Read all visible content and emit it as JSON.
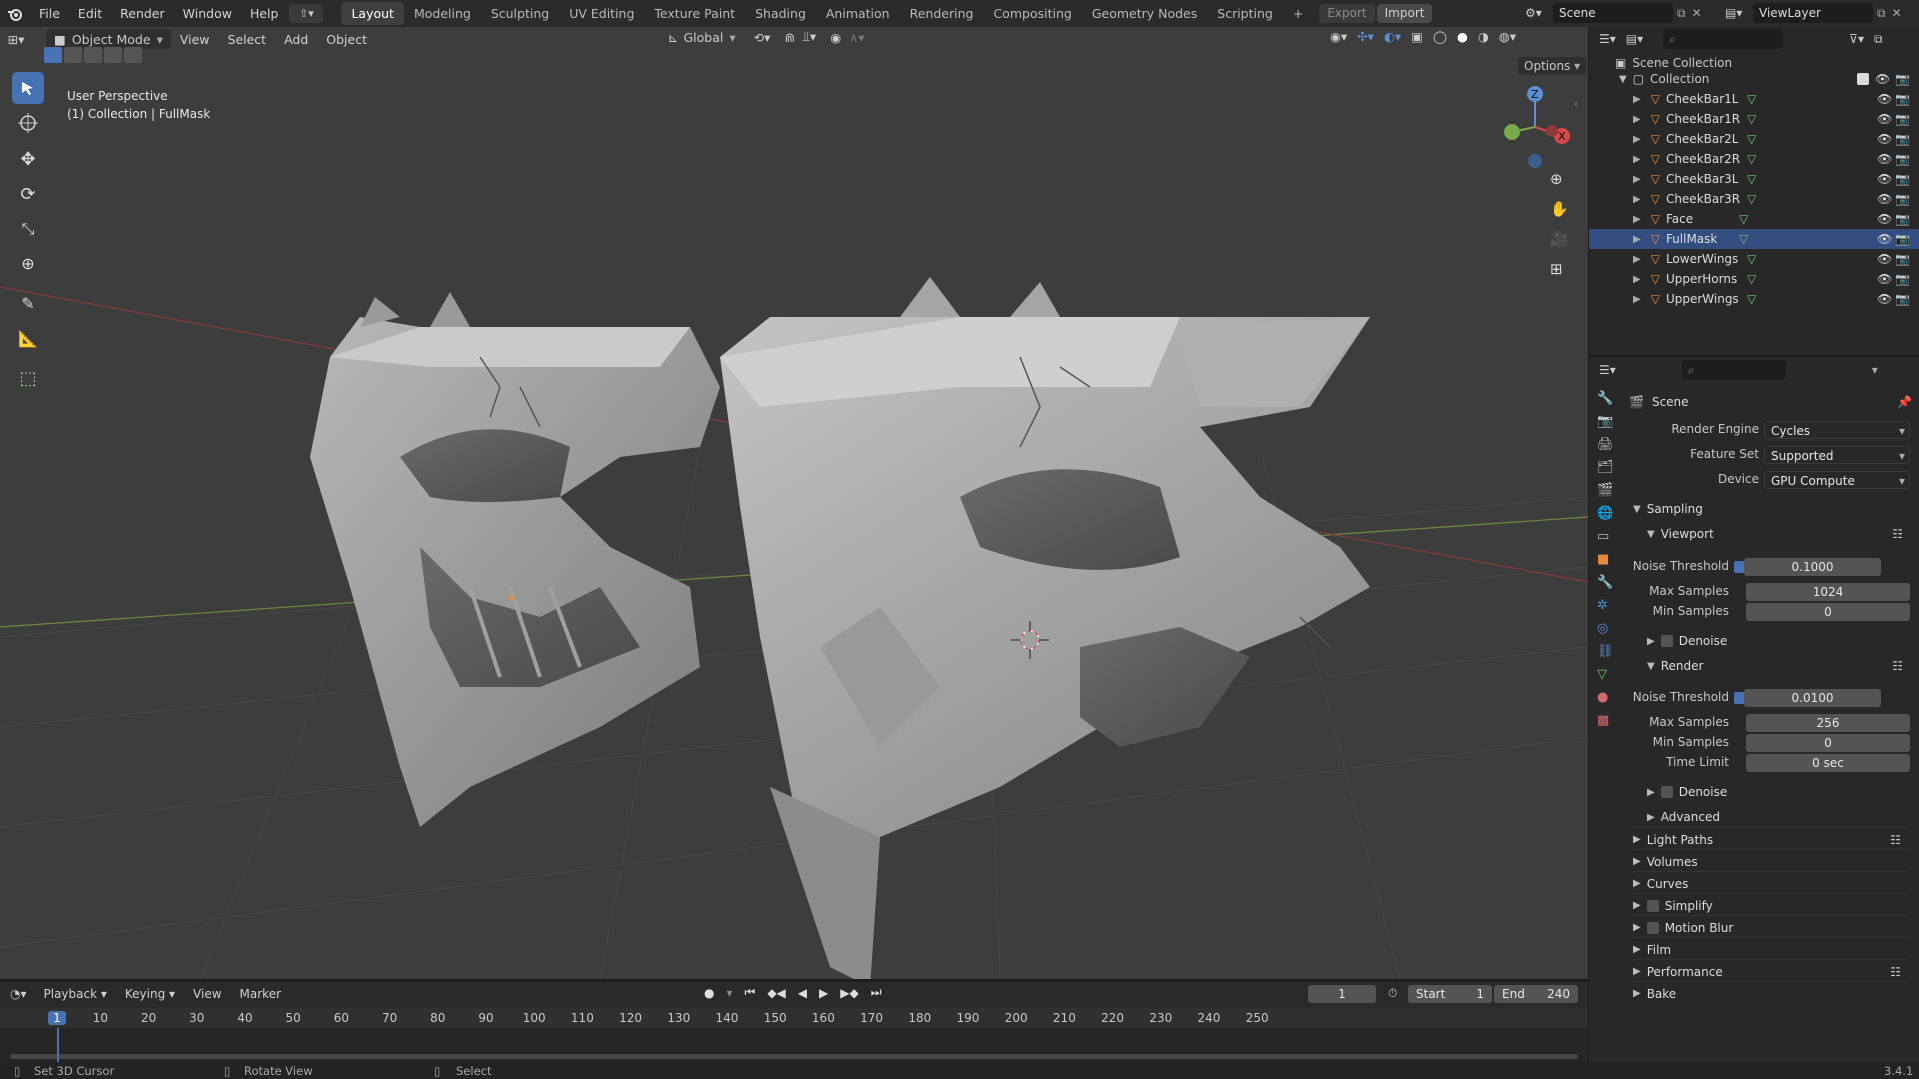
{
  "menus": [
    "File",
    "Edit",
    "Render",
    "Window",
    "Help"
  ],
  "workspaces": [
    "Layout",
    "Modeling",
    "Sculpting",
    "UV Editing",
    "Texture Paint",
    "Shading",
    "Animation",
    "Rendering",
    "Compositing",
    "Geometry Nodes",
    "Scripting"
  ],
  "active_workspace": "Layout",
  "topbar": {
    "export_label": "Export",
    "import_label": "Import",
    "scene_name": "Scene",
    "viewlayer_name": "ViewLayer",
    "add_tab": "+"
  },
  "viewport": {
    "mode": "Object Mode",
    "menus": [
      "View",
      "Select",
      "Add",
      "Object"
    ],
    "transform_orientation": "Global",
    "options_label": "Options",
    "overlay_line1": "User Perspective",
    "overlay_line2": "(1) Collection | FullMask",
    "gizmo_axes": [
      "Z",
      "X",
      "Y"
    ]
  },
  "outliner": {
    "scene_collection": "Scene Collection",
    "collection": "Collection",
    "objects": [
      {
        "name": "CheekBar1L"
      },
      {
        "name": "CheekBar1R"
      },
      {
        "name": "CheekBar2L"
      },
      {
        "name": "CheekBar2R"
      },
      {
        "name": "CheekBar3L"
      },
      {
        "name": "CheekBar3R"
      },
      {
        "name": "Face"
      },
      {
        "name": "FullMask"
      },
      {
        "name": "LowerWings"
      },
      {
        "name": "UpperHorns"
      },
      {
        "name": "UpperWings"
      }
    ],
    "selected": "FullMask"
  },
  "properties": {
    "context": "Scene",
    "render_engine_label": "Render Engine",
    "render_engine": "Cycles",
    "feature_set_label": "Feature Set",
    "feature_set": "Supported",
    "device_label": "Device",
    "device": "GPU Compute",
    "sampling": "Sampling",
    "viewport": {
      "title": "Viewport",
      "noise_threshold_label": "Noise Threshold",
      "noise_threshold": "0.1000",
      "max_samples_label": "Max Samples",
      "max_samples": "1024",
      "min_samples_label": "Min Samples",
      "min_samples": "0",
      "denoise": "Denoise"
    },
    "render": {
      "title": "Render",
      "noise_threshold_label": "Noise Threshold",
      "noise_threshold": "0.0100",
      "max_samples_label": "Max Samples",
      "max_samples": "256",
      "min_samples_label": "Min Samples",
      "min_samples": "0",
      "time_limit_label": "Time Limit",
      "time_limit": "0 sec",
      "denoise": "Denoise",
      "advanced": "Advanced"
    },
    "panels": [
      "Light Paths",
      "Volumes",
      "Curves",
      "Simplify",
      "Motion Blur",
      "Film",
      "Performance",
      "Bake"
    ]
  },
  "timeline": {
    "menus": [
      "Playback",
      "Keying",
      "View",
      "Marker"
    ],
    "current_frame": "1",
    "start_label": "Start",
    "start": "1",
    "end_label": "End",
    "end": "240",
    "ticks": [
      "1",
      "10",
      "20",
      "30",
      "40",
      "50",
      "60",
      "70",
      "80",
      "90",
      "100",
      "110",
      "120",
      "130",
      "140",
      "150",
      "160",
      "170",
      "180",
      "190",
      "200",
      "210",
      "220",
      "230",
      "240",
      "250"
    ]
  },
  "statusbar": {
    "left": "Set 3D Cursor",
    "middle": "Rotate View",
    "right": "Select",
    "version": "3.4.1"
  },
  "colors": {
    "accent": "#4772b3",
    "object_orange": "#e28a3a",
    "mesh_green": "#6cc26c",
    "active_frame": "#4772b3"
  }
}
